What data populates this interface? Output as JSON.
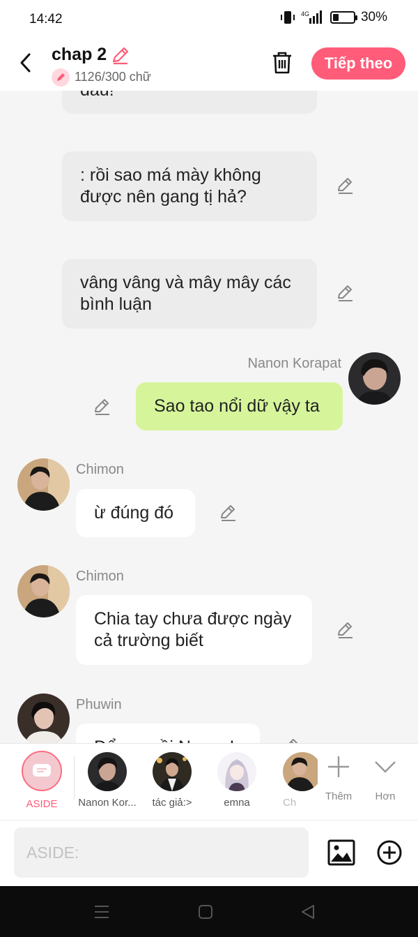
{
  "status": {
    "time": "14:42",
    "network": "4G",
    "battery": "30%",
    "battery_level": 0.3
  },
  "header": {
    "title": "chap 2",
    "word_count": "1126/300 chữ",
    "next_label": "Tiếp theo"
  },
  "messages": [
    {
      "text": "đâu!",
      "style": "gray"
    },
    {
      "text": ": rồi sao má mày không được nên gang tị hả?",
      "style": "gray"
    },
    {
      "text": "vâng vâng và mây mây các bình luận",
      "style": "gray"
    },
    {
      "sender": "Nanon Korapat",
      "text": "Sao tao nổi dữ vậy ta",
      "style": "green"
    },
    {
      "sender": "Chimon",
      "text": "ừ đúng đó",
      "style": "white"
    },
    {
      "sender": "Chimon",
      "text": "Chia tay chưa được ngày cả trường biết",
      "style": "white"
    },
    {
      "sender": "Phuwin",
      "text": "Để nay rồi Nanon!",
      "style": "white"
    }
  ],
  "characters": [
    {
      "label": "ASIDE",
      "selected": true
    },
    {
      "label": "Nanon Kor..."
    },
    {
      "label": "tác giả:>"
    },
    {
      "label": "emna"
    },
    {
      "label": "Chi"
    }
  ],
  "actions": {
    "add_label": "Thêm",
    "more_label": "Hơn"
  },
  "input": {
    "placeholder": "ASIDE:"
  },
  "colors": {
    "accent": "#ff5c79",
    "green_bubble": "#d6f59b",
    "gray_bubble": "#ececec"
  }
}
